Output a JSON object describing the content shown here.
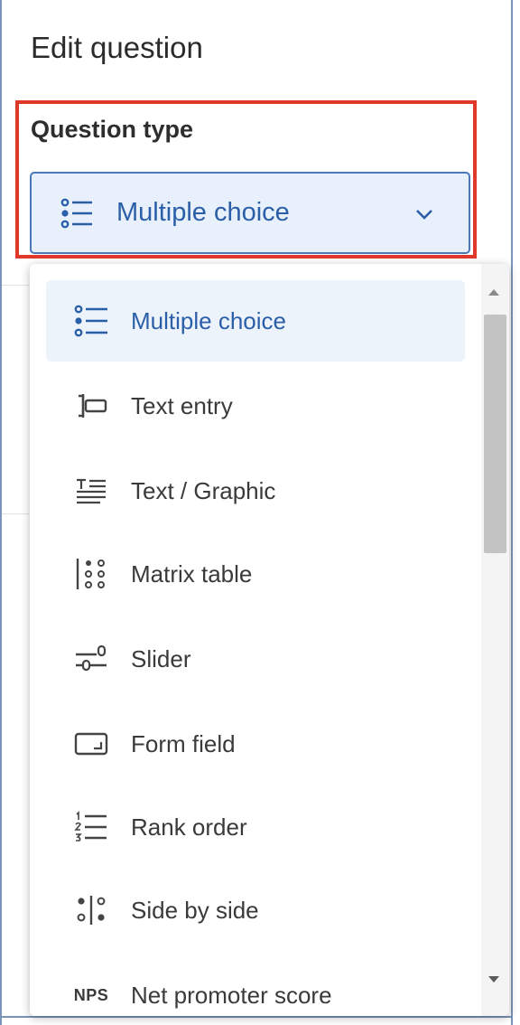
{
  "panel": {
    "title": "Edit question",
    "question_type_label": "Question type"
  },
  "select": {
    "value": "Multiple choice",
    "icon": "list-bullets-icon",
    "chevron": "chevron-down-icon"
  },
  "menu": {
    "items": [
      {
        "label": "Multiple choice",
        "icon": "list-bullets-icon",
        "selected": true
      },
      {
        "label": "Text entry",
        "icon": "text-entry-icon",
        "selected": false
      },
      {
        "label": "Text / Graphic",
        "icon": "text-graphic-icon",
        "selected": false
      },
      {
        "label": "Matrix table",
        "icon": "matrix-table-icon",
        "selected": false
      },
      {
        "label": "Slider",
        "icon": "slider-icon",
        "selected": false
      },
      {
        "label": "Form field",
        "icon": "form-field-icon",
        "selected": false
      },
      {
        "label": "Rank order",
        "icon": "rank-order-icon",
        "selected": false
      },
      {
        "label": "Side by side",
        "icon": "side-by-side-icon",
        "selected": false
      },
      {
        "label": "Net promoter score",
        "icon": "nps-icon",
        "icon_text": "NPS",
        "selected": false
      }
    ]
  },
  "colors": {
    "accent": "#2a5fa8",
    "highlight_border": "#e0392b",
    "select_background": "#e7f0fb",
    "selected_item_background": "#edf3fb"
  }
}
